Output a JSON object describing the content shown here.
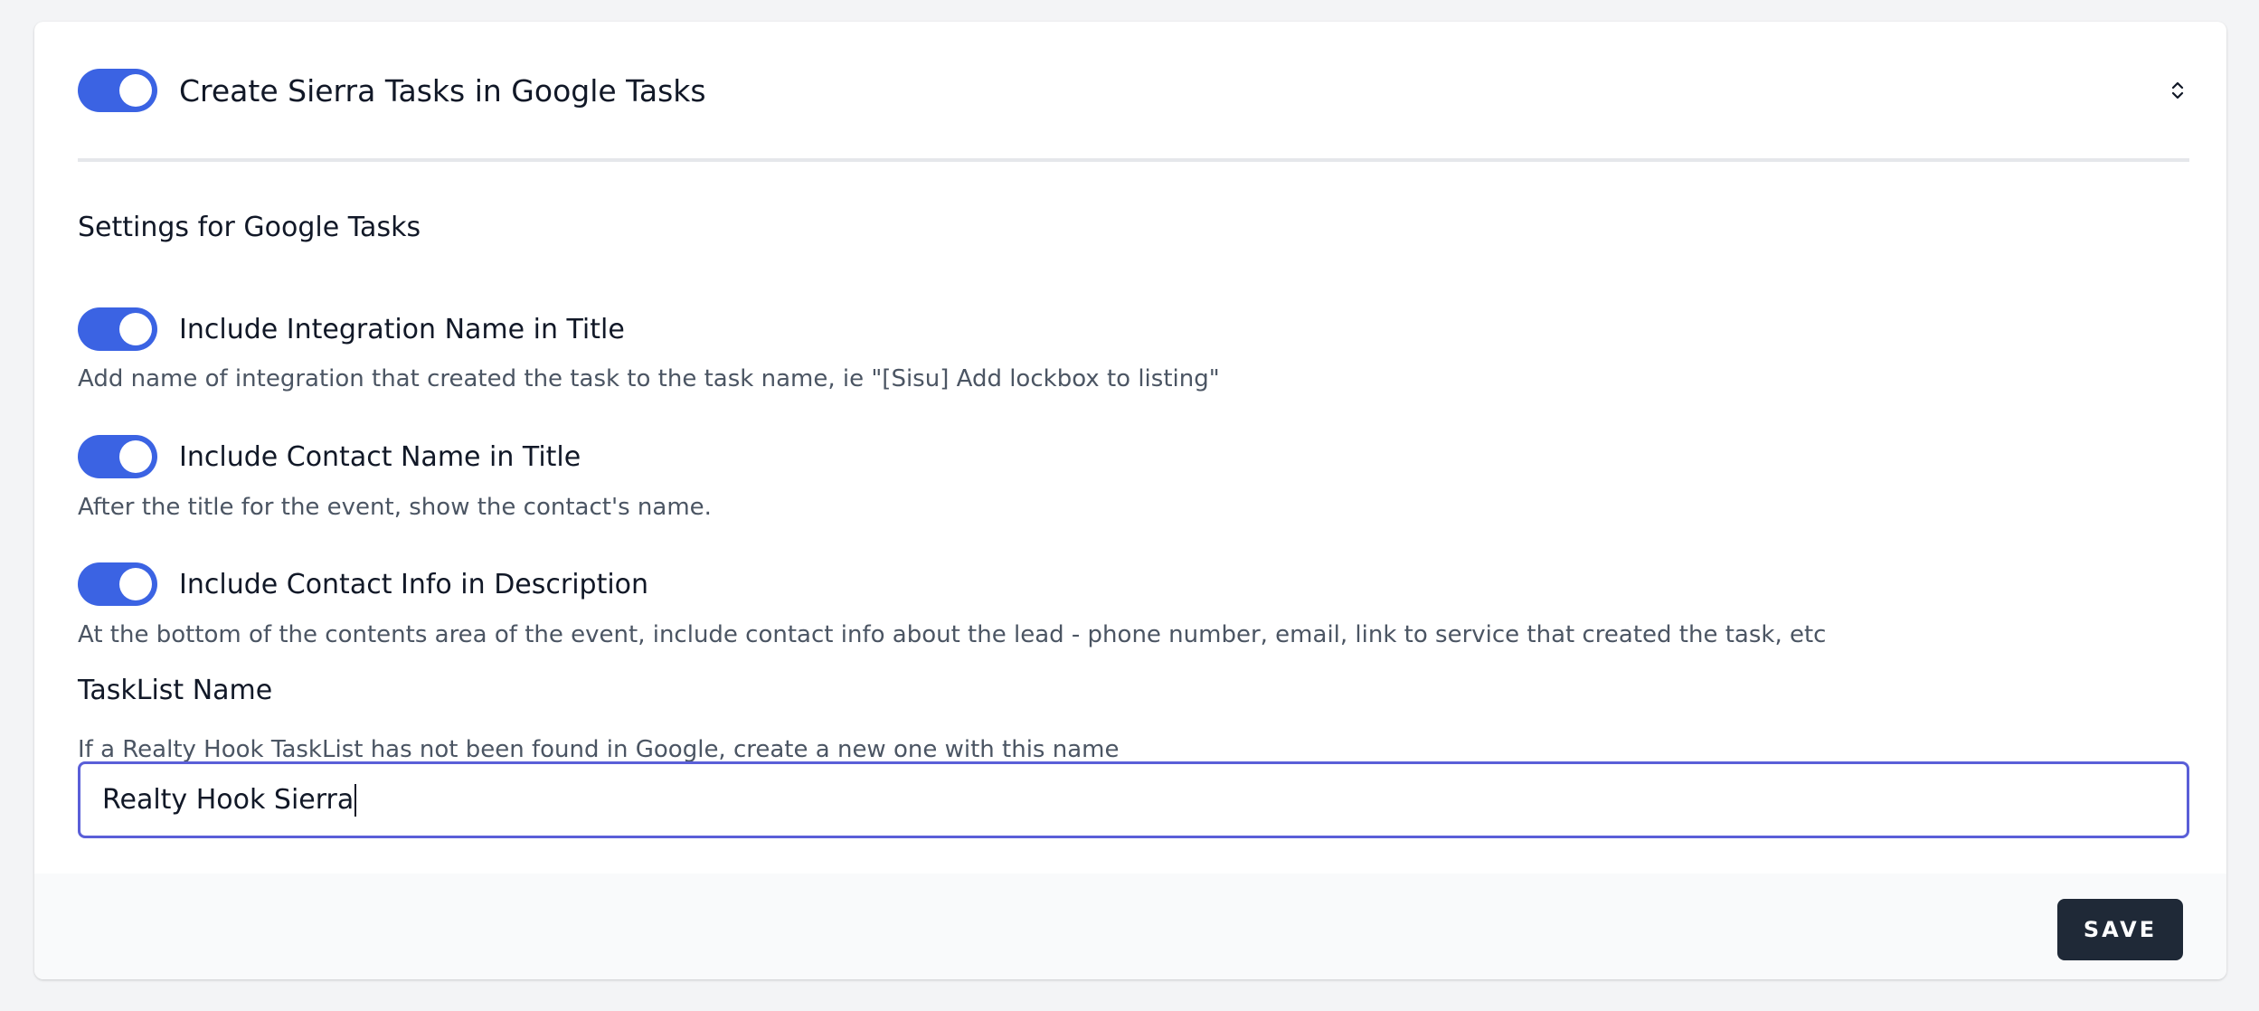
{
  "header": {
    "title": "Create Sierra Tasks in Google Tasks",
    "enabled": true,
    "collapse_icon": "chevron-up-down-icon"
  },
  "settings": {
    "section_title": "Settings for Google Tasks",
    "options": [
      {
        "label": "Include Integration Name in Title",
        "description": "Add name of integration that created the task to the task name, ie \"[Sisu] Add lockbox to listing\"",
        "enabled": true
      },
      {
        "label": "Include Contact Name in Title",
        "description": "After the title for the event, show the contact's name.",
        "enabled": true
      },
      {
        "label": "Include Contact Info in Description",
        "description": "At the bottom of the contents area of the event, include contact info about the lead - phone number, email, link to service that created the task, etc",
        "enabled": true
      }
    ],
    "tasklist": {
      "label": "TaskList Name",
      "help": "If a Realty Hook TaskList has not been found in Google, create a new one with this name",
      "value": "Realty Hook Sierra"
    }
  },
  "footer": {
    "save_label": "SAVE"
  },
  "colors": {
    "toggle_on": "#3b63e3",
    "input_focus_border": "#5a5fd8",
    "save_button_bg": "#1f2937"
  }
}
